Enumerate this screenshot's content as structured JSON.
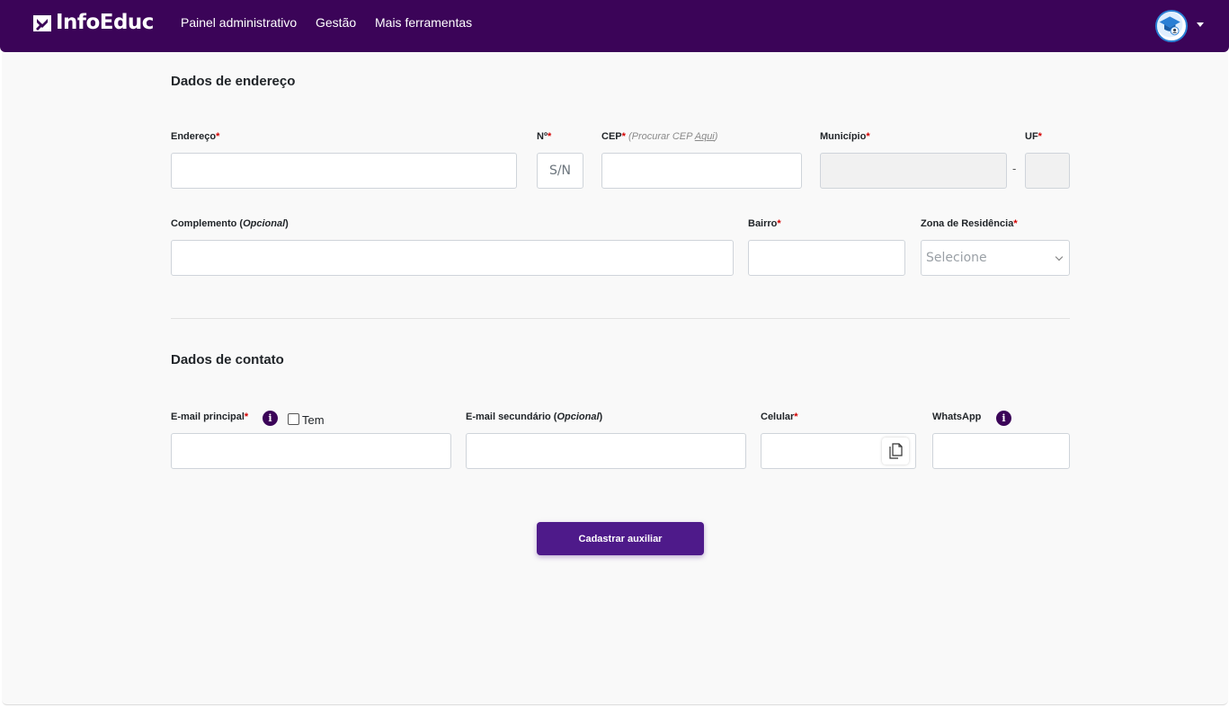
{
  "navbar": {
    "brand": "InfoEduc",
    "items": [
      {
        "label": "Painel administrativo"
      },
      {
        "label": "Gestão"
      },
      {
        "label": "Mais ferramentas"
      }
    ],
    "colors": {
      "background": "#3b0458"
    }
  },
  "address": {
    "title": "Dados de endereço",
    "endereco_label": "Endereço",
    "numero_label": "Nº",
    "numero_value": "S/N",
    "cep_label": "CEP",
    "cep_hint_prefix": "(Procurar CEP ",
    "cep_hint_link": "Aqui",
    "cep_hint_suffix": ")",
    "municipio_label": "Município",
    "uf_label": "UF",
    "separator": "-",
    "complemento_label": "Complemento (",
    "complemento_opt": "Opcional",
    "complemento_close": ")",
    "bairro_label": "Bairro",
    "zona_label": "Zona de Residência",
    "zona_value": "Selecione"
  },
  "contact": {
    "title": "Dados de contato",
    "email_label": "E-mail principal",
    "email_info_icon": "info-icon",
    "tem_label": "Tem",
    "email2_label": "E-mail secundário (",
    "email2_opt": "Opcional",
    "email2_close": ")",
    "celular_label": "Celular",
    "copy_icon": "copy-icon",
    "whatsapp_label": "WhatsApp",
    "whatsapp_info_icon": "info-icon"
  },
  "required_marker": "*",
  "info_glyph": "i",
  "submit_label": "Cadastrar auxiliar",
  "colors": {
    "accent": "#4e1a8a",
    "required": "#d40000"
  }
}
